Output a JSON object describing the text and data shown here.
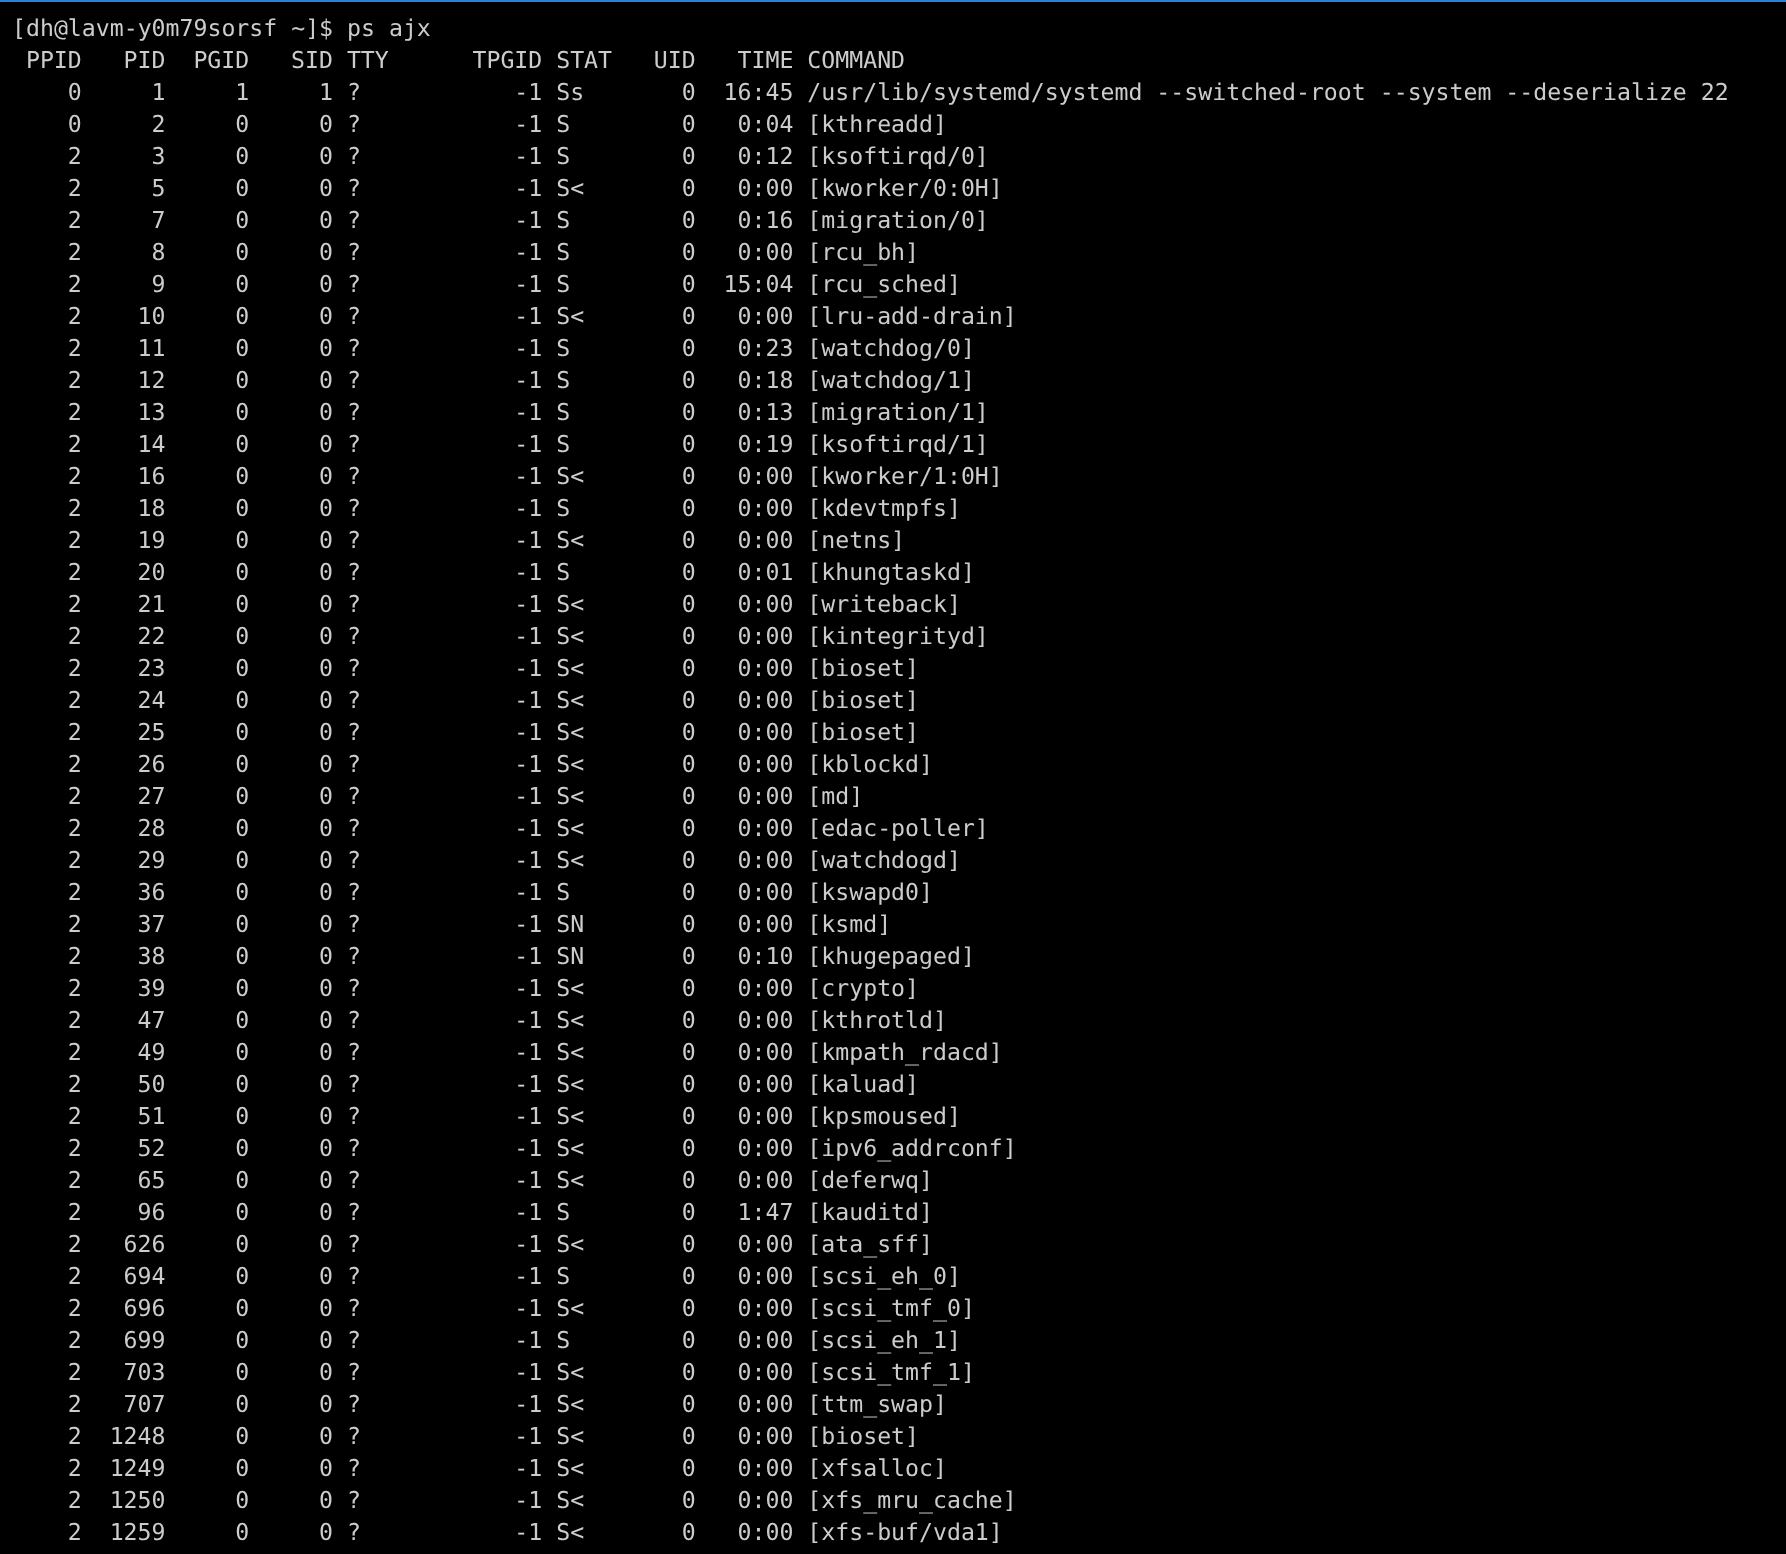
{
  "terminal": {
    "prompt": "[dh@lavm-y0m79sorsf ~]$ ps ajx",
    "columns": [
      "PPID",
      "PID",
      "PGID",
      "SID",
      "TTY",
      "TPGID",
      "STAT",
      "UID",
      "TIME",
      "COMMAND"
    ],
    "rows": [
      [
        "0",
        "1",
        "1",
        "1",
        "?",
        "-1",
        "Ss",
        "0",
        "16:45",
        "/usr/lib/systemd/systemd --switched-root --system --deserialize 22"
      ],
      [
        "0",
        "2",
        "0",
        "0",
        "?",
        "-1",
        "S",
        "0",
        "0:04",
        "[kthreadd]"
      ],
      [
        "2",
        "3",
        "0",
        "0",
        "?",
        "-1",
        "S",
        "0",
        "0:12",
        "[ksoftirqd/0]"
      ],
      [
        "2",
        "5",
        "0",
        "0",
        "?",
        "-1",
        "S<",
        "0",
        "0:00",
        "[kworker/0:0H]"
      ],
      [
        "2",
        "7",
        "0",
        "0",
        "?",
        "-1",
        "S",
        "0",
        "0:16",
        "[migration/0]"
      ],
      [
        "2",
        "8",
        "0",
        "0",
        "?",
        "-1",
        "S",
        "0",
        "0:00",
        "[rcu_bh]"
      ],
      [
        "2",
        "9",
        "0",
        "0",
        "?",
        "-1",
        "S",
        "0",
        "15:04",
        "[rcu_sched]"
      ],
      [
        "2",
        "10",
        "0",
        "0",
        "?",
        "-1",
        "S<",
        "0",
        "0:00",
        "[lru-add-drain]"
      ],
      [
        "2",
        "11",
        "0",
        "0",
        "?",
        "-1",
        "S",
        "0",
        "0:23",
        "[watchdog/0]"
      ],
      [
        "2",
        "12",
        "0",
        "0",
        "?",
        "-1",
        "S",
        "0",
        "0:18",
        "[watchdog/1]"
      ],
      [
        "2",
        "13",
        "0",
        "0",
        "?",
        "-1",
        "S",
        "0",
        "0:13",
        "[migration/1]"
      ],
      [
        "2",
        "14",
        "0",
        "0",
        "?",
        "-1",
        "S",
        "0",
        "0:19",
        "[ksoftirqd/1]"
      ],
      [
        "2",
        "16",
        "0",
        "0",
        "?",
        "-1",
        "S<",
        "0",
        "0:00",
        "[kworker/1:0H]"
      ],
      [
        "2",
        "18",
        "0",
        "0",
        "?",
        "-1",
        "S",
        "0",
        "0:00",
        "[kdevtmpfs]"
      ],
      [
        "2",
        "19",
        "0",
        "0",
        "?",
        "-1",
        "S<",
        "0",
        "0:00",
        "[netns]"
      ],
      [
        "2",
        "20",
        "0",
        "0",
        "?",
        "-1",
        "S",
        "0",
        "0:01",
        "[khungtaskd]"
      ],
      [
        "2",
        "21",
        "0",
        "0",
        "?",
        "-1",
        "S<",
        "0",
        "0:00",
        "[writeback]"
      ],
      [
        "2",
        "22",
        "0",
        "0",
        "?",
        "-1",
        "S<",
        "0",
        "0:00",
        "[kintegrityd]"
      ],
      [
        "2",
        "23",
        "0",
        "0",
        "?",
        "-1",
        "S<",
        "0",
        "0:00",
        "[bioset]"
      ],
      [
        "2",
        "24",
        "0",
        "0",
        "?",
        "-1",
        "S<",
        "0",
        "0:00",
        "[bioset]"
      ],
      [
        "2",
        "25",
        "0",
        "0",
        "?",
        "-1",
        "S<",
        "0",
        "0:00",
        "[bioset]"
      ],
      [
        "2",
        "26",
        "0",
        "0",
        "?",
        "-1",
        "S<",
        "0",
        "0:00",
        "[kblockd]"
      ],
      [
        "2",
        "27",
        "0",
        "0",
        "?",
        "-1",
        "S<",
        "0",
        "0:00",
        "[md]"
      ],
      [
        "2",
        "28",
        "0",
        "0",
        "?",
        "-1",
        "S<",
        "0",
        "0:00",
        "[edac-poller]"
      ],
      [
        "2",
        "29",
        "0",
        "0",
        "?",
        "-1",
        "S<",
        "0",
        "0:00",
        "[watchdogd]"
      ],
      [
        "2",
        "36",
        "0",
        "0",
        "?",
        "-1",
        "S",
        "0",
        "0:00",
        "[kswapd0]"
      ],
      [
        "2",
        "37",
        "0",
        "0",
        "?",
        "-1",
        "SN",
        "0",
        "0:00",
        "[ksmd]"
      ],
      [
        "2",
        "38",
        "0",
        "0",
        "?",
        "-1",
        "SN",
        "0",
        "0:10",
        "[khugepaged]"
      ],
      [
        "2",
        "39",
        "0",
        "0",
        "?",
        "-1",
        "S<",
        "0",
        "0:00",
        "[crypto]"
      ],
      [
        "2",
        "47",
        "0",
        "0",
        "?",
        "-1",
        "S<",
        "0",
        "0:00",
        "[kthrotld]"
      ],
      [
        "2",
        "49",
        "0",
        "0",
        "?",
        "-1",
        "S<",
        "0",
        "0:00",
        "[kmpath_rdacd]"
      ],
      [
        "2",
        "50",
        "0",
        "0",
        "?",
        "-1",
        "S<",
        "0",
        "0:00",
        "[kaluad]"
      ],
      [
        "2",
        "51",
        "0",
        "0",
        "?",
        "-1",
        "S<",
        "0",
        "0:00",
        "[kpsmoused]"
      ],
      [
        "2",
        "52",
        "0",
        "0",
        "?",
        "-1",
        "S<",
        "0",
        "0:00",
        "[ipv6_addrconf]"
      ],
      [
        "2",
        "65",
        "0",
        "0",
        "?",
        "-1",
        "S<",
        "0",
        "0:00",
        "[deferwq]"
      ],
      [
        "2",
        "96",
        "0",
        "0",
        "?",
        "-1",
        "S",
        "0",
        "1:47",
        "[kauditd]"
      ],
      [
        "2",
        "626",
        "0",
        "0",
        "?",
        "-1",
        "S<",
        "0",
        "0:00",
        "[ata_sff]"
      ],
      [
        "2",
        "694",
        "0",
        "0",
        "?",
        "-1",
        "S",
        "0",
        "0:00",
        "[scsi_eh_0]"
      ],
      [
        "2",
        "696",
        "0",
        "0",
        "?",
        "-1",
        "S<",
        "0",
        "0:00",
        "[scsi_tmf_0]"
      ],
      [
        "2",
        "699",
        "0",
        "0",
        "?",
        "-1",
        "S",
        "0",
        "0:00",
        "[scsi_eh_1]"
      ],
      [
        "2",
        "703",
        "0",
        "0",
        "?",
        "-1",
        "S<",
        "0",
        "0:00",
        "[scsi_tmf_1]"
      ],
      [
        "2",
        "707",
        "0",
        "0",
        "?",
        "-1",
        "S<",
        "0",
        "0:00",
        "[ttm_swap]"
      ],
      [
        "2",
        "1248",
        "0",
        "0",
        "?",
        "-1",
        "S<",
        "0",
        "0:00",
        "[bioset]"
      ],
      [
        "2",
        "1249",
        "0",
        "0",
        "?",
        "-1",
        "S<",
        "0",
        "0:00",
        "[xfsalloc]"
      ],
      [
        "2",
        "1250",
        "0",
        "0",
        "?",
        "-1",
        "S<",
        "0",
        "0:00",
        "[xfs_mru_cache]"
      ],
      [
        "2",
        "1259",
        "0",
        "0",
        "?",
        "-1",
        "S<",
        "0",
        "0:00",
        "[xfs-buf/vda1]"
      ]
    ]
  }
}
